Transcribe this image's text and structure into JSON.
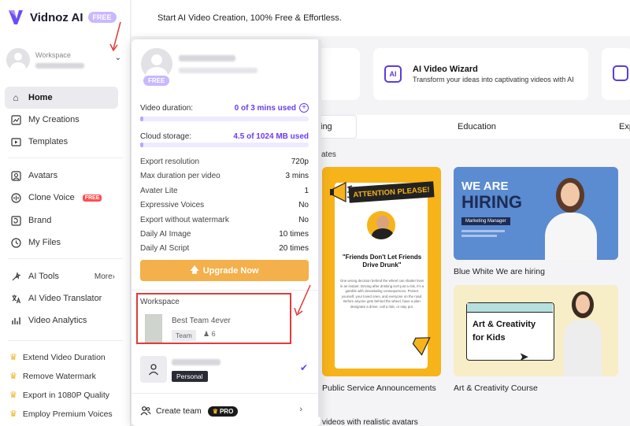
{
  "app": {
    "name": "Vidnoz AI",
    "badge": "FREE"
  },
  "sidebar": {
    "workspace_label": "Workspace",
    "nav": [
      {
        "label": "Home",
        "icon": "home-icon"
      },
      {
        "label": "My Creations",
        "icon": "creations-icon"
      },
      {
        "label": "Templates",
        "icon": "templates-icon"
      },
      {
        "label": "Avatars",
        "icon": "avatars-icon"
      },
      {
        "label": "Clone Voice",
        "icon": "voice-icon",
        "badge": "FREE"
      },
      {
        "label": "Brand",
        "icon": "brand-icon"
      },
      {
        "label": "My Files",
        "icon": "files-icon"
      },
      {
        "label": "AI Tools",
        "icon": "tools-icon",
        "more": "More"
      },
      {
        "label": "AI Video Translator",
        "icon": "translator-icon"
      },
      {
        "label": "Video Analytics",
        "icon": "analytics-icon"
      }
    ],
    "promos": [
      "Extend Video Duration",
      "Remove Watermark",
      "Export in 1080P Quality",
      "Employ Premium Voices"
    ]
  },
  "topbar": {
    "text": "Start AI Video Creation, 100% Free & Effortless."
  },
  "tool_card": {
    "title": "AI Video Wizard",
    "subtitle": "Transform your ideas into captivating videos with AI",
    "icon_text": "AI"
  },
  "tabs": [
    "ing",
    "Education",
    "Exp"
  ],
  "section_title": "ates",
  "templates": [
    {
      "caption": "Public Service Announcements",
      "heading": "ATTENTION PLEASE!",
      "quote": "\"Friends Don't Let Friends Drive Drunk\"",
      "body": "One wrong decision behind the wheel can shatter lives in an instant. Driving after drinking isn't just a risk, it's a gamble with devastating consequences. Protect yourself, your loved ones, and everyone on the road. Before anyone gets behind the wheel, have a plan designate a driver, call a ride, or stay put."
    },
    {
      "caption": "Blue White We are hiring",
      "line1": "WE ARE",
      "line2": "HIRING",
      "role": "Marketing Manager"
    },
    {
      "caption": "Art & Creativity Course",
      "line1": "Art & Creativity",
      "line2": "for Kids"
    }
  ],
  "bottom_text": "videos with realistic avatars",
  "dropdown": {
    "badge": "FREE",
    "video_duration": {
      "label": "Video duration:",
      "value": "0 of 3 mins used",
      "fraction": 0.02
    },
    "cloud_storage": {
      "label": "Cloud storage:",
      "value": "4.5 of 1024 MB used",
      "fraction": 0.01
    },
    "features": [
      {
        "label": "Export resolution",
        "value": "720p"
      },
      {
        "label": "Max duration per video",
        "value": "3 mins"
      },
      {
        "label": "Avater Lite",
        "value": "1"
      },
      {
        "label": "Expressive Voices",
        "value": "No"
      },
      {
        "label": "Export without watermark",
        "value": "No"
      },
      {
        "label": "Daily AI Image",
        "value": "10 times"
      },
      {
        "label": "Daily AI Script",
        "value": "20 times"
      }
    ],
    "upgrade_label": "Upgrade Now",
    "workspace_label": "Workspace",
    "team": {
      "name": "Best Team 4ever",
      "tag": "Team",
      "members": "6"
    },
    "personal": {
      "tag": "Personal"
    },
    "create_team": {
      "label": "Create team",
      "badge": "PRO"
    }
  },
  "colors": {
    "accent": "#6a3cf0",
    "upgrade": "#f4b04b",
    "highlight": "#e23a3a"
  }
}
